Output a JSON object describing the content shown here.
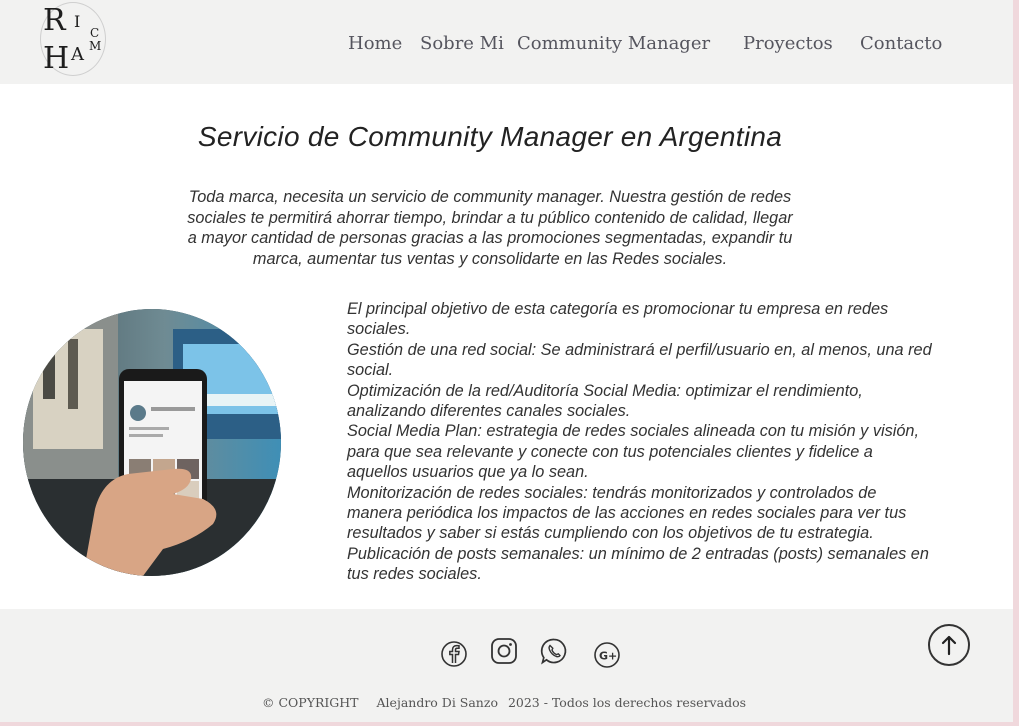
{
  "header": {
    "logo": {
      "letter_r": "R",
      "letter_i": "I",
      "letter_c": "C",
      "letter_h": "H",
      "letter_a": "A",
      "letter_m": "M"
    },
    "nav": [
      {
        "label": "Home"
      },
      {
        "label": "Sobre Mi"
      },
      {
        "label": "Community Manager"
      },
      {
        "label": "Proyectos"
      },
      {
        "label": "Contacto"
      }
    ]
  },
  "main": {
    "title": "Servicio de Community Manager en Argentina",
    "intro": "Toda marca, necesita un servicio de community manager. Nuestra gestión de redes sociales te permitirá ahorrar tiempo, brindar a tu público contenido de calidad, llegar a mayor cantidad de personas gracias a las promociones segmentadas, expandir tu marca, aumentar tus ventas y consolidarte en las Redes sociales.",
    "services": [
      "El principal objetivo de esta categoría es promocionar tu empresa en redes sociales.",
      "Gestión de una red social: Se administrará el perfil/usuario en, al menos, una red social.",
      "Optimización de la red/Auditoría Social Media: optimizar el rendimiento, analizando diferentes canales sociales.",
      "Social Media Plan: estrategia de redes sociales alineada con tu misión y visión, para que sea relevante y conecte con tus potenciales clientes y fidelice a aquellos usuarios que ya lo sean.",
      "Monitorización de redes sociales: tendrás monitorizados y controlados de manera periódica los impactos de las acciones en redes sociales para ver tus resultados y saber si estás cumpliendo con los objetivos de tu estrategia.",
      "Publicación de posts semanales: un mínimo de 2 entradas (posts) semanales en tus redes sociales."
    ]
  },
  "footer": {
    "social_icons": [
      "facebook-icon",
      "instagram-icon",
      "whatsapp-icon",
      "google-plus-icon"
    ],
    "copyright_prefix": "© COPYRIGHT",
    "author": "Alejandro Di Sanzo",
    "year_text": "2023 -  Todos los derechos reservados"
  },
  "colors": {
    "header_bg": "#f2f2f1",
    "page_bg": "#ffffff",
    "border_pink": "#f0d8dc",
    "text": "#333333",
    "nav_text": "#55555e"
  }
}
